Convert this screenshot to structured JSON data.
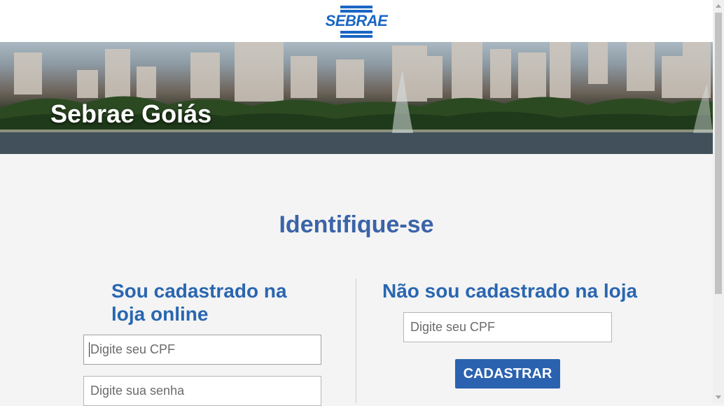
{
  "header": {
    "logo_text": "SEBRAE"
  },
  "banner": {
    "title": "Sebrae Goiás"
  },
  "main": {
    "heading": "Identifique-se",
    "left": {
      "heading": "Sou cadastrado na loja online",
      "cpf_placeholder": "Digite seu CPF",
      "password_placeholder": "Digite sua senha"
    },
    "right": {
      "heading": "Não sou cadastrado na loja",
      "cpf_placeholder": "Digite seu CPF",
      "button_label": "CADASTRAR"
    }
  },
  "colors": {
    "brand_blue": "#1a66c4",
    "heading_blue": "#3b64a8",
    "button_blue": "#2a62b0",
    "background": "#f4f4f4"
  }
}
